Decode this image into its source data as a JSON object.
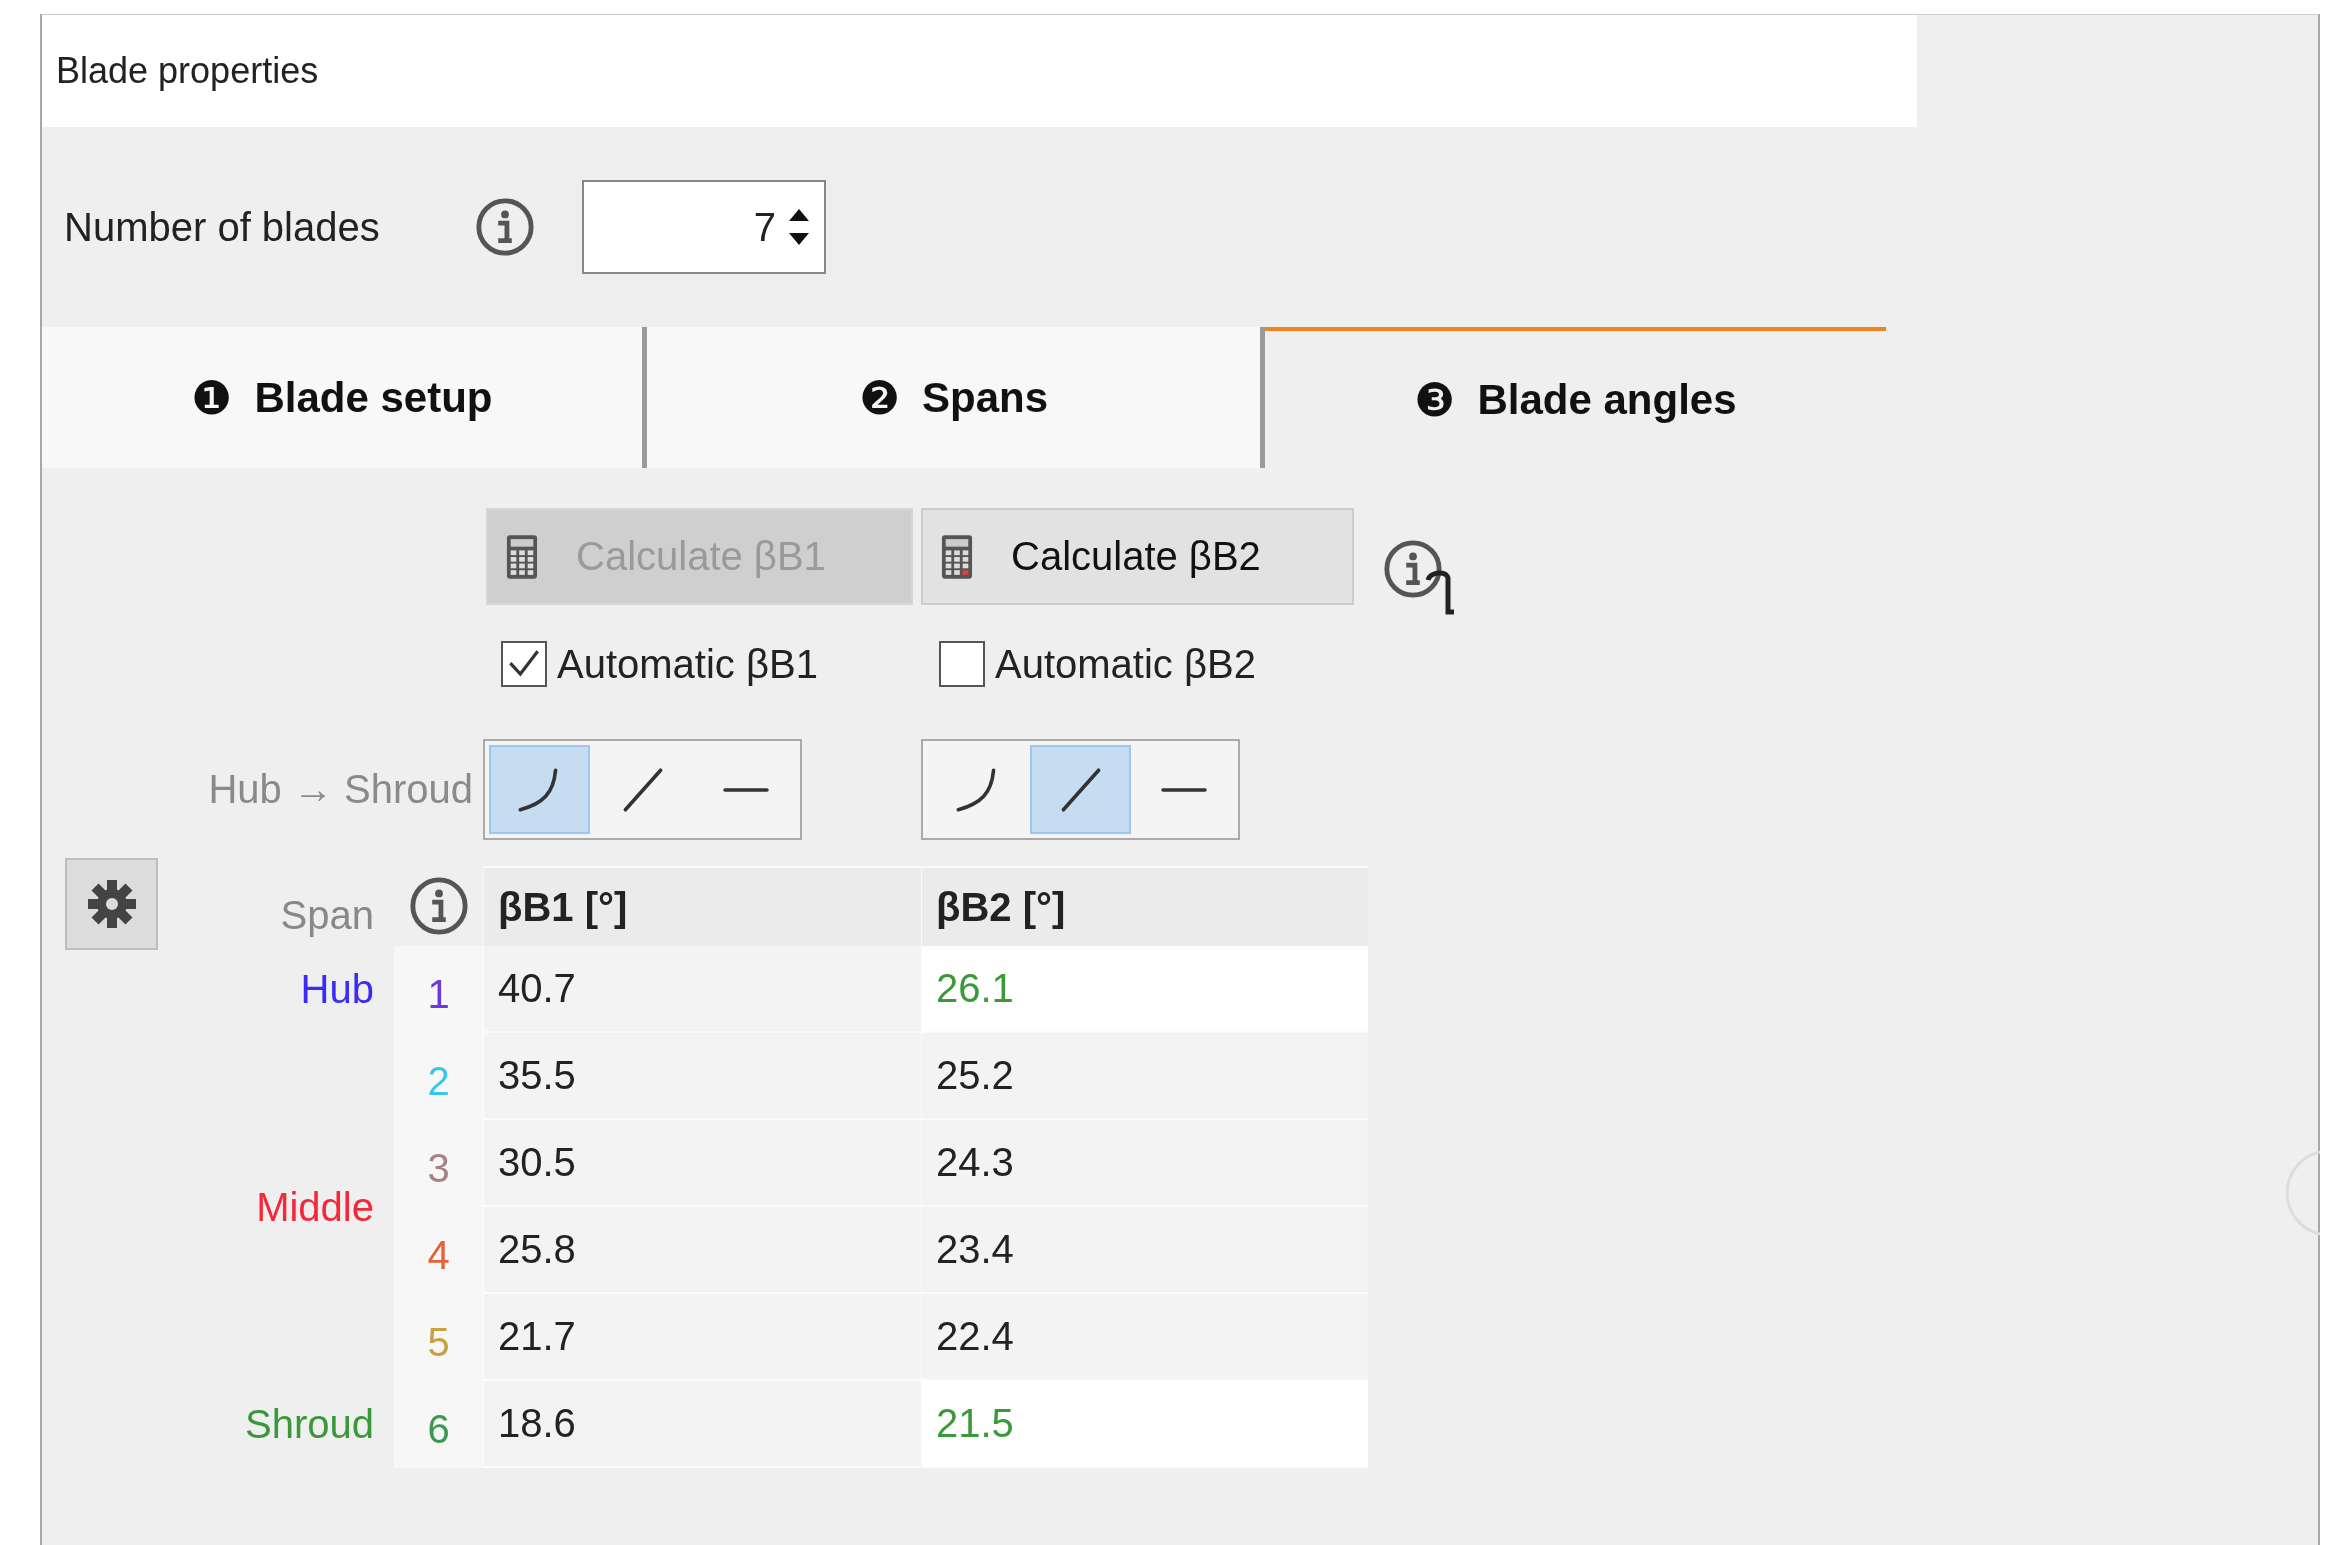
{
  "panel_title": "Blade properties",
  "blade_count": {
    "label": "Number of blades",
    "value": "7"
  },
  "tabs": [
    {
      "number": "❶",
      "label": "Blade setup",
      "selected": false
    },
    {
      "number": "❷",
      "label": "Spans",
      "selected": false
    },
    {
      "number": "❸",
      "label": "Blade angles",
      "selected": true
    }
  ],
  "calc_buttons": [
    {
      "label": "Calculate βB1",
      "disabled": true
    },
    {
      "label": "Calculate βB2",
      "disabled": false
    }
  ],
  "auto_checks": [
    {
      "label": "Automatic βB1",
      "checked": true
    },
    {
      "label": "Automatic βB2",
      "checked": false
    }
  ],
  "distribution": {
    "label": "Hub → Shroud",
    "groups": [
      {
        "options": [
          {
            "kind": "curve",
            "selected": true
          },
          {
            "kind": "line",
            "selected": false
          },
          {
            "kind": "flat",
            "selected": false
          }
        ]
      },
      {
        "options": [
          {
            "kind": "curve",
            "selected": false
          },
          {
            "kind": "line",
            "selected": true
          },
          {
            "kind": "flat",
            "selected": false
          }
        ]
      }
    ]
  },
  "table": {
    "span_header": "Span",
    "columns": [
      "βB1 [°]",
      "βB2 [°]"
    ],
    "span_labels": [
      {
        "text": "Hub",
        "kind": "start",
        "color": "#3a2cf5"
      },
      {
        "text": "Middle",
        "kind": "middle",
        "color": "#f5283a"
      },
      {
        "text": "Shroud",
        "kind": "end",
        "color": "#3a983a"
      }
    ],
    "rows": [
      {
        "index": "1",
        "color": "#6a3ae0",
        "cells": [
          {
            "text": "40.7",
            "highlighted": false
          },
          {
            "text": "26.1",
            "highlighted": true
          }
        ]
      },
      {
        "index": "2",
        "color": "#38c6f0",
        "cells": [
          {
            "text": "35.5",
            "highlighted": false
          },
          {
            "text": "25.2",
            "highlighted": false
          }
        ]
      },
      {
        "index": "3",
        "color": "#a88282",
        "cells": [
          {
            "text": "30.5",
            "highlighted": false
          },
          {
            "text": "24.3",
            "highlighted": false
          }
        ]
      },
      {
        "index": "4",
        "color": "#e8603a",
        "cells": [
          {
            "text": "25.8",
            "highlighted": false
          },
          {
            "text": "23.4",
            "highlighted": false
          }
        ]
      },
      {
        "index": "5",
        "color": "#c8a040",
        "cells": [
          {
            "text": "21.7",
            "highlighted": false
          },
          {
            "text": "22.4",
            "highlighted": false
          }
        ]
      },
      {
        "index": "6",
        "color": "#3a9a50",
        "cells": [
          {
            "text": "18.6",
            "highlighted": false
          },
          {
            "text": "21.5",
            "highlighted": true
          }
        ]
      }
    ]
  }
}
